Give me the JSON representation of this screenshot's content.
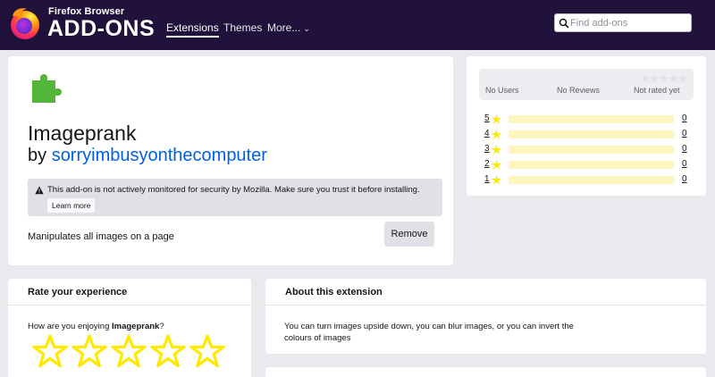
{
  "header": {
    "brand_small": "Firefox Browser",
    "brand_big": "ADD-ONS",
    "nav": [
      {
        "label": "Extensions",
        "active": true
      },
      {
        "label": "Themes",
        "active": false
      },
      {
        "label": "More...",
        "active": false
      }
    ],
    "search": {
      "placeholder": "Find add-ons",
      "value": ""
    }
  },
  "addon": {
    "icon": "puzzle-piece-icon",
    "name": "Imageprank",
    "by": "by",
    "author": "sorryimbusyonthecomputer",
    "warning": "This add-on is not actively monitored for security by Mozilla. Make sure you trust it before installing.",
    "learn_more": "Learn more",
    "summary": "Manipulates all images on a page",
    "remove_label": "Remove"
  },
  "ratings": {
    "users": "No Users",
    "reviews": "No Reviews",
    "rating": "Not rated yet",
    "bars": [
      {
        "stars": "5",
        "count": "0"
      },
      {
        "stars": "4",
        "count": "0"
      },
      {
        "stars": "3",
        "count": "0"
      },
      {
        "stars": "2",
        "count": "0"
      },
      {
        "stars": "1",
        "count": "0"
      }
    ]
  },
  "rate": {
    "title": "Rate your experience",
    "question_prefix": "How are you enjoying ",
    "question_name": "Imageprank",
    "question_suffix": "?"
  },
  "about": {
    "title": "About this extension",
    "text": "You can turn images upside down, you can blur images, or you can invert the colours of images"
  },
  "colors": {
    "header_bg": "#20123a",
    "link": "#0060df",
    "star": "#ffe900",
    "bar": "#fff5bf"
  }
}
